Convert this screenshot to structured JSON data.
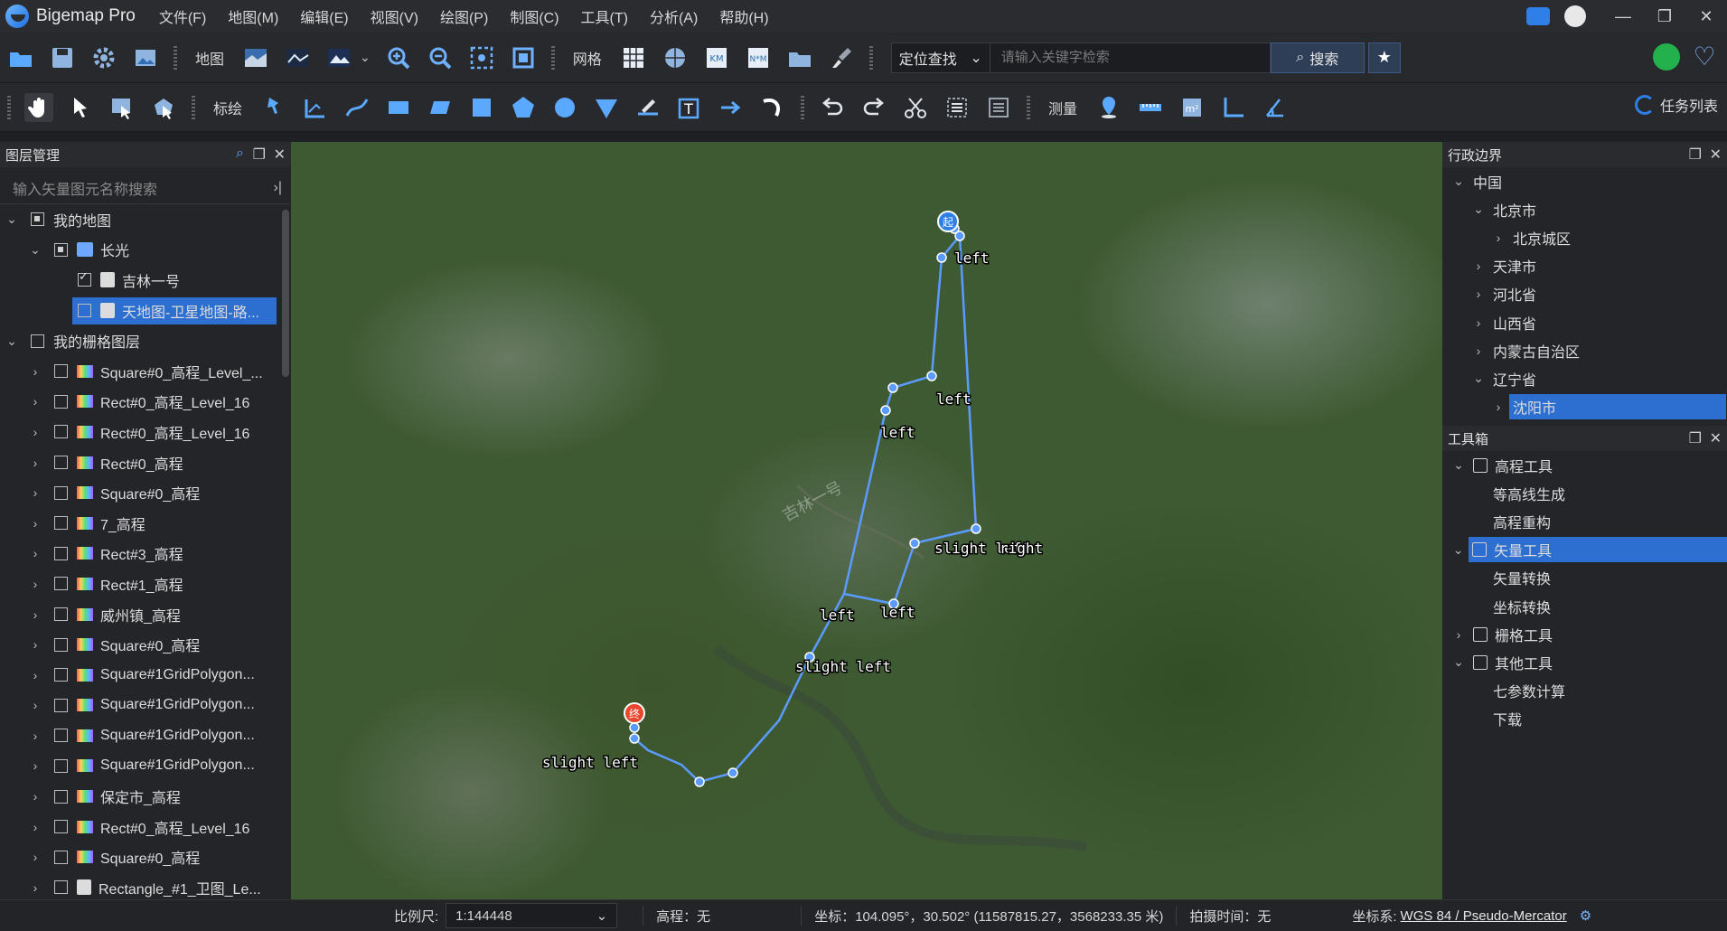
{
  "app": {
    "name": "Bigemap Pro"
  },
  "menu": [
    "文件(F)",
    "地图(M)",
    "编辑(E)",
    "视图(V)",
    "绘图(P)",
    "制图(C)",
    "工具(T)",
    "分析(A)",
    "帮助(H)"
  ],
  "toolbar1": {
    "map_label": "地图",
    "grid_label": "网格",
    "locate_label": "定位查找",
    "search_placeholder": "请输入关键字检索",
    "search_button": "搜索"
  },
  "toolbar2": {
    "annotate_label": "标绘",
    "measure_label": "测量",
    "task_list": "任务列表"
  },
  "layer_panel": {
    "title": "图层管理",
    "search_placeholder": "输入矢量图元名称搜索",
    "rows": [
      {
        "label": "我的地图",
        "level": 0,
        "chevron": "open",
        "check": "partial",
        "icon": "none"
      },
      {
        "label": "长光",
        "level": 1,
        "chevron": "open",
        "check": "partial",
        "icon": "folder"
      },
      {
        "label": "吉林一号",
        "level": 2,
        "chevron": "none",
        "check": "checked",
        "icon": "doc"
      },
      {
        "label": "天地图-卫星地图-路...",
        "level": 2,
        "chevron": "none",
        "check": "unchecked",
        "icon": "doc",
        "selected": true
      },
      {
        "label": "我的栅格图层",
        "level": 0,
        "chevron": "open",
        "check": "unchecked",
        "icon": "none"
      },
      {
        "label": "Square#0_高程_Level_...",
        "level": 1,
        "chevron": "closed",
        "check": "unchecked",
        "icon": "raster"
      },
      {
        "label": "Rect#0_高程_Level_16",
        "level": 1,
        "chevron": "closed",
        "check": "unchecked",
        "icon": "raster"
      },
      {
        "label": "Rect#0_高程_Level_16",
        "level": 1,
        "chevron": "closed",
        "check": "unchecked",
        "icon": "raster"
      },
      {
        "label": "Rect#0_高程",
        "level": 1,
        "chevron": "closed",
        "check": "unchecked",
        "icon": "raster"
      },
      {
        "label": "Square#0_高程",
        "level": 1,
        "chevron": "closed",
        "check": "unchecked",
        "icon": "raster"
      },
      {
        "label": "7_高程",
        "level": 1,
        "chevron": "closed",
        "check": "unchecked",
        "icon": "raster"
      },
      {
        "label": "Rect#3_高程",
        "level": 1,
        "chevron": "closed",
        "check": "unchecked",
        "icon": "raster"
      },
      {
        "label": "Rect#1_高程",
        "level": 1,
        "chevron": "closed",
        "check": "unchecked",
        "icon": "raster"
      },
      {
        "label": "威州镇_高程",
        "level": 1,
        "chevron": "closed",
        "check": "unchecked",
        "icon": "raster"
      },
      {
        "label": "Square#0_高程",
        "level": 1,
        "chevron": "closed",
        "check": "unchecked",
        "icon": "raster"
      },
      {
        "label": "Square#1GridPolygon...",
        "level": 1,
        "chevron": "closed",
        "check": "unchecked",
        "icon": "raster"
      },
      {
        "label": "Square#1GridPolygon...",
        "level": 1,
        "chevron": "closed",
        "check": "unchecked",
        "icon": "raster"
      },
      {
        "label": "Square#1GridPolygon...",
        "level": 1,
        "chevron": "closed",
        "check": "unchecked",
        "icon": "raster"
      },
      {
        "label": "Square#1GridPolygon...",
        "level": 1,
        "chevron": "closed",
        "check": "unchecked",
        "icon": "raster"
      },
      {
        "label": "保定市_高程",
        "level": 1,
        "chevron": "closed",
        "check": "unchecked",
        "icon": "raster"
      },
      {
        "label": "Rect#0_高程_Level_16",
        "level": 1,
        "chevron": "closed",
        "check": "unchecked",
        "icon": "raster"
      },
      {
        "label": "Square#0_高程",
        "level": 1,
        "chevron": "closed",
        "check": "unchecked",
        "icon": "raster"
      },
      {
        "label": "Rectangle_#1_卫图_Le...",
        "level": 1,
        "chevron": "closed",
        "check": "unchecked",
        "icon": "doc"
      }
    ]
  },
  "map": {
    "watermark": "吉林一号",
    "start_marker": "起",
    "end_marker": "终",
    "labels": [
      "left",
      "left",
      "left",
      "slight left",
      "right",
      "left",
      "left",
      "slight left",
      "slight left"
    ]
  },
  "boundary_panel": {
    "title": "行政边界",
    "rows": [
      {
        "label": "中国",
        "level": 0,
        "chevron": "open"
      },
      {
        "label": "北京市",
        "level": 1,
        "chevron": "open"
      },
      {
        "label": "北京城区",
        "level": 2,
        "chevron": "closed"
      },
      {
        "label": "天津市",
        "level": 1,
        "chevron": "closed"
      },
      {
        "label": "河北省",
        "level": 1,
        "chevron": "closed"
      },
      {
        "label": "山西省",
        "level": 1,
        "chevron": "closed"
      },
      {
        "label": "内蒙古自治区",
        "level": 1,
        "chevron": "closed"
      },
      {
        "label": "辽宁省",
        "level": 1,
        "chevron": "open"
      },
      {
        "label": "沈阳市",
        "level": 2,
        "chevron": "closed",
        "selected": true
      }
    ]
  },
  "toolbox_panel": {
    "title": "工具箱",
    "rows": [
      {
        "label": "高程工具",
        "level": 0,
        "chevron": "open",
        "icon": true
      },
      {
        "label": "等高线生成",
        "level": 1,
        "chevron": "none"
      },
      {
        "label": "高程重构",
        "level": 1,
        "chevron": "none"
      },
      {
        "label": "矢量工具",
        "level": 0,
        "chevron": "open",
        "icon": true,
        "selected": true
      },
      {
        "label": "矢量转换",
        "level": 1,
        "chevron": "none"
      },
      {
        "label": "坐标转换",
        "level": 1,
        "chevron": "none"
      },
      {
        "label": "栅格工具",
        "level": 0,
        "chevron": "closed",
        "icon": true
      },
      {
        "label": "其他工具",
        "level": 0,
        "chevron": "open",
        "icon": true
      },
      {
        "label": "七参数计算",
        "level": 1,
        "chevron": "none"
      },
      {
        "label": "下载",
        "level": 1,
        "chevron": "none"
      }
    ]
  },
  "status": {
    "scale_label": "比例尺:",
    "scale_value": "1:144448",
    "elevation": "高程：无",
    "coords": "坐标：104.095°，30.502°   (11587815.27，3568233.35 米)",
    "capture_time": "拍摄时间：无",
    "crs_label": "坐标系:",
    "crs_value": "WGS 84 / Pseudo-Mercator"
  },
  "colors": {
    "accent": "#2c6fd0",
    "route": "#5b9bff",
    "background": "#1f2023"
  }
}
